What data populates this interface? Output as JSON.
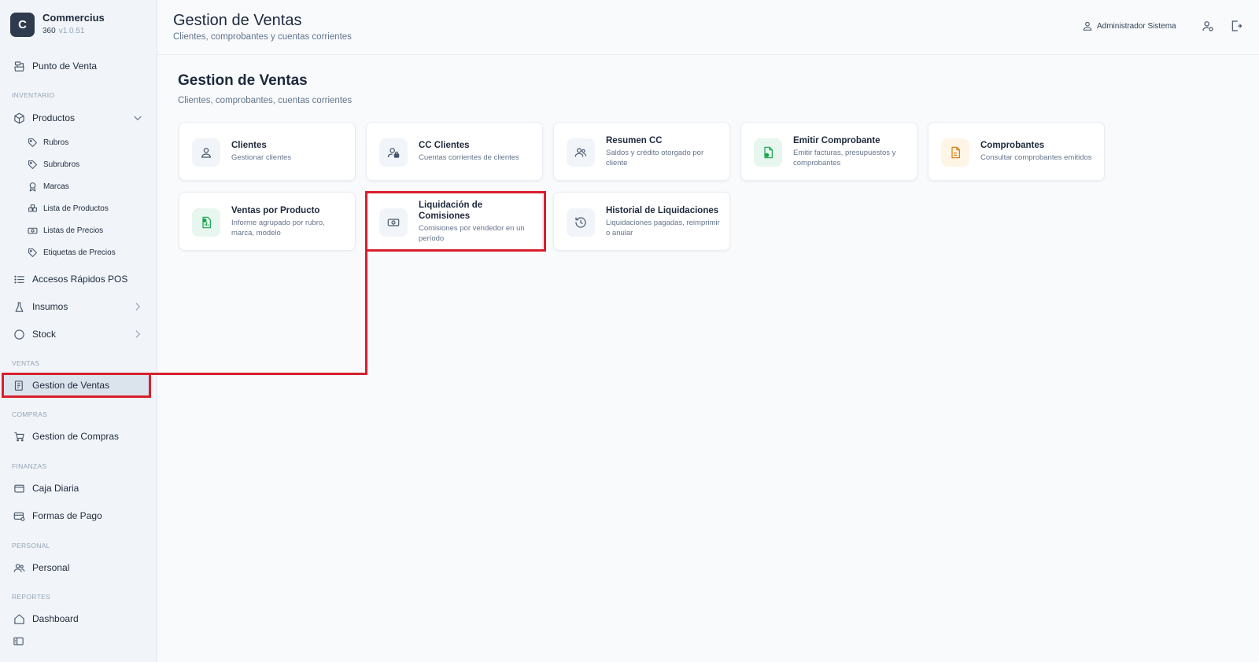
{
  "brand": {
    "logo_letter": "C",
    "name": "Commercius",
    "sub": "360",
    "version": "v1.0.51"
  },
  "sidebar": {
    "pos": "Punto de Venta",
    "sections": {
      "inventario": "INVENTARIO",
      "ventas": "VENTAS",
      "compras": "COMPRAS",
      "finanzas": "FINANZAS",
      "personal": "PERSONAL",
      "reportes": "REPORTES"
    },
    "productos": {
      "label": "Productos",
      "children": [
        "Rubros",
        "Subrubros",
        "Marcas",
        "Lista de Productos",
        "Listas de Precios",
        "Etiquetas de Precios"
      ]
    },
    "accesos": "Accesos Rápidos POS",
    "insumos": "Insumos",
    "stock": "Stock",
    "gestion_ventas": "Gestion de Ventas",
    "gestion_compras": "Gestion de Compras",
    "caja_diaria": "Caja Diaria",
    "formas_pago": "Formas de Pago",
    "personal": "Personal",
    "dashboard": "Dashboard",
    "active_item": "Gestion de Ventas"
  },
  "header": {
    "title": "Gestion de Ventas",
    "subtitle": "Clientes, comprobantes y cuentas corrientes",
    "user": "Administrador Sistema",
    "icons": [
      "user-icon",
      "user-settings-icon",
      "logout-icon"
    ]
  },
  "main": {
    "title": "Gestion de Ventas",
    "subtitle": "Clientes, comprobantes, cuentas corrientes",
    "cards": [
      {
        "title": "Clientes",
        "desc": "Gestionar clientes",
        "icon": "user-icon"
      },
      {
        "title": "CC Clientes",
        "desc": "Cuentas corrientes de clientes",
        "icon": "user-lock-icon"
      },
      {
        "title": "Resumen CC",
        "desc": "Saldos y crédito otorgado por cliente",
        "icon": "users-icon"
      },
      {
        "title": "Emitir Comprobante",
        "desc": "Emitir facturas, presupuestos y comprobantes",
        "icon": "file-plus-icon"
      },
      {
        "title": "Comprobantes",
        "desc": "Consultar comprobantes emitidos",
        "icon": "file-icon"
      },
      {
        "title": "Ventas por Producto",
        "desc": "Informe agrupado por rubro, marca, modelo",
        "icon": "chart-file-icon"
      },
      {
        "title": "Liquidación de Comisiones",
        "desc": "Comisiones por vendedor en un período",
        "icon": "banknote-icon"
      },
      {
        "title": "Historial de Liquidaciones",
        "desc": "Liquidaciones pagadas, reimprimir o anular",
        "icon": "history-icon"
      }
    ],
    "highlighted_card": "Liquidación de Comisiones"
  },
  "colors": {
    "accent_dark": "#2e3a4d",
    "highlight_red": "#d7202c",
    "green_icon": "#16a34a",
    "amber_icon": "#d97706",
    "active_nav_bg": "#dbe3ec"
  }
}
